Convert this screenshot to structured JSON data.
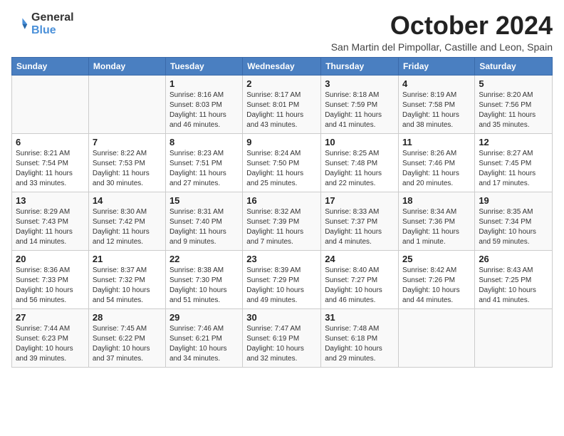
{
  "logo": {
    "text1": "General",
    "text2": "Blue"
  },
  "title": "October 2024",
  "location": "San Martin del Pimpollar, Castille and Leon, Spain",
  "headers": [
    "Sunday",
    "Monday",
    "Tuesday",
    "Wednesday",
    "Thursday",
    "Friday",
    "Saturday"
  ],
  "weeks": [
    [
      {
        "day": "",
        "content": ""
      },
      {
        "day": "",
        "content": ""
      },
      {
        "day": "1",
        "content": "Sunrise: 8:16 AM\nSunset: 8:03 PM\nDaylight: 11 hours\nand 46 minutes."
      },
      {
        "day": "2",
        "content": "Sunrise: 8:17 AM\nSunset: 8:01 PM\nDaylight: 11 hours\nand 43 minutes."
      },
      {
        "day": "3",
        "content": "Sunrise: 8:18 AM\nSunset: 7:59 PM\nDaylight: 11 hours\nand 41 minutes."
      },
      {
        "day": "4",
        "content": "Sunrise: 8:19 AM\nSunset: 7:58 PM\nDaylight: 11 hours\nand 38 minutes."
      },
      {
        "day": "5",
        "content": "Sunrise: 8:20 AM\nSunset: 7:56 PM\nDaylight: 11 hours\nand 35 minutes."
      }
    ],
    [
      {
        "day": "6",
        "content": "Sunrise: 8:21 AM\nSunset: 7:54 PM\nDaylight: 11 hours\nand 33 minutes."
      },
      {
        "day": "7",
        "content": "Sunrise: 8:22 AM\nSunset: 7:53 PM\nDaylight: 11 hours\nand 30 minutes."
      },
      {
        "day": "8",
        "content": "Sunrise: 8:23 AM\nSunset: 7:51 PM\nDaylight: 11 hours\nand 27 minutes."
      },
      {
        "day": "9",
        "content": "Sunrise: 8:24 AM\nSunset: 7:50 PM\nDaylight: 11 hours\nand 25 minutes."
      },
      {
        "day": "10",
        "content": "Sunrise: 8:25 AM\nSunset: 7:48 PM\nDaylight: 11 hours\nand 22 minutes."
      },
      {
        "day": "11",
        "content": "Sunrise: 8:26 AM\nSunset: 7:46 PM\nDaylight: 11 hours\nand 20 minutes."
      },
      {
        "day": "12",
        "content": "Sunrise: 8:27 AM\nSunset: 7:45 PM\nDaylight: 11 hours\nand 17 minutes."
      }
    ],
    [
      {
        "day": "13",
        "content": "Sunrise: 8:29 AM\nSunset: 7:43 PM\nDaylight: 11 hours\nand 14 minutes."
      },
      {
        "day": "14",
        "content": "Sunrise: 8:30 AM\nSunset: 7:42 PM\nDaylight: 11 hours\nand 12 minutes."
      },
      {
        "day": "15",
        "content": "Sunrise: 8:31 AM\nSunset: 7:40 PM\nDaylight: 11 hours\nand 9 minutes."
      },
      {
        "day": "16",
        "content": "Sunrise: 8:32 AM\nSunset: 7:39 PM\nDaylight: 11 hours\nand 7 minutes."
      },
      {
        "day": "17",
        "content": "Sunrise: 8:33 AM\nSunset: 7:37 PM\nDaylight: 11 hours\nand 4 minutes."
      },
      {
        "day": "18",
        "content": "Sunrise: 8:34 AM\nSunset: 7:36 PM\nDaylight: 11 hours\nand 1 minute."
      },
      {
        "day": "19",
        "content": "Sunrise: 8:35 AM\nSunset: 7:34 PM\nDaylight: 10 hours\nand 59 minutes."
      }
    ],
    [
      {
        "day": "20",
        "content": "Sunrise: 8:36 AM\nSunset: 7:33 PM\nDaylight: 10 hours\nand 56 minutes."
      },
      {
        "day": "21",
        "content": "Sunrise: 8:37 AM\nSunset: 7:32 PM\nDaylight: 10 hours\nand 54 minutes."
      },
      {
        "day": "22",
        "content": "Sunrise: 8:38 AM\nSunset: 7:30 PM\nDaylight: 10 hours\nand 51 minutes."
      },
      {
        "day": "23",
        "content": "Sunrise: 8:39 AM\nSunset: 7:29 PM\nDaylight: 10 hours\nand 49 minutes."
      },
      {
        "day": "24",
        "content": "Sunrise: 8:40 AM\nSunset: 7:27 PM\nDaylight: 10 hours\nand 46 minutes."
      },
      {
        "day": "25",
        "content": "Sunrise: 8:42 AM\nSunset: 7:26 PM\nDaylight: 10 hours\nand 44 minutes."
      },
      {
        "day": "26",
        "content": "Sunrise: 8:43 AM\nSunset: 7:25 PM\nDaylight: 10 hours\nand 41 minutes."
      }
    ],
    [
      {
        "day": "27",
        "content": "Sunrise: 7:44 AM\nSunset: 6:23 PM\nDaylight: 10 hours\nand 39 minutes."
      },
      {
        "day": "28",
        "content": "Sunrise: 7:45 AM\nSunset: 6:22 PM\nDaylight: 10 hours\nand 37 minutes."
      },
      {
        "day": "29",
        "content": "Sunrise: 7:46 AM\nSunset: 6:21 PM\nDaylight: 10 hours\nand 34 minutes."
      },
      {
        "day": "30",
        "content": "Sunrise: 7:47 AM\nSunset: 6:19 PM\nDaylight: 10 hours\nand 32 minutes."
      },
      {
        "day": "31",
        "content": "Sunrise: 7:48 AM\nSunset: 6:18 PM\nDaylight: 10 hours\nand 29 minutes."
      },
      {
        "day": "",
        "content": ""
      },
      {
        "day": "",
        "content": ""
      }
    ]
  ]
}
